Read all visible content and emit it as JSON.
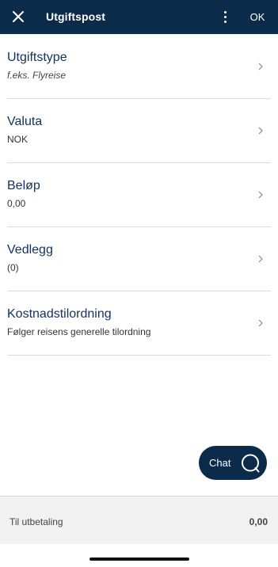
{
  "header": {
    "title": "Utgiftspost",
    "ok_label": "OK"
  },
  "rows": [
    {
      "label": "Utgiftstype",
      "value": "f.eks. Flyreise"
    },
    {
      "label": "Valuta",
      "value": "NOK"
    },
    {
      "label": "Beløp",
      "value": "0,00"
    },
    {
      "label": "Vedlegg",
      "value": "(0)"
    },
    {
      "label": "Kostnadstilordning",
      "value": "Følger reisens generelle tilordning"
    }
  ],
  "chat": {
    "label": "Chat"
  },
  "footer": {
    "label": "Til utbetaling",
    "value": "0,00"
  },
  "colors": {
    "header_bg": "#0c2a4a",
    "text_primary": "#13315c",
    "footer_bg": "#f1f1f1"
  },
  "icons": [
    "close-icon",
    "more-vertical-icon",
    "chevron-right-icon",
    "chat-bubble-icon"
  ]
}
